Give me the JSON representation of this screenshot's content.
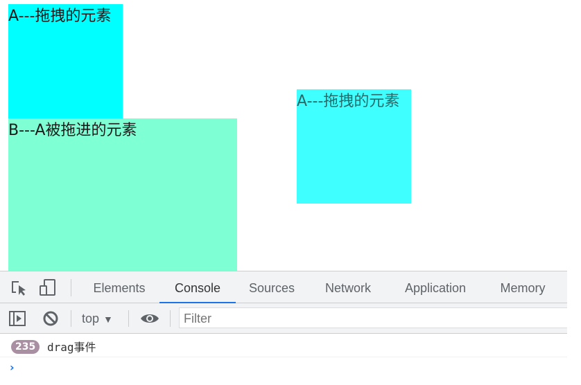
{
  "page": {
    "box_a": {
      "label": "A---拖拽的元素",
      "color": "#00ffff"
    },
    "box_b": {
      "label": "B---A被拖进的元素",
      "color": "#7fffd4"
    },
    "drag_ghost": {
      "label": "A---拖拽的元素"
    }
  },
  "devtools": {
    "toolbar_icons": [
      "inspect-element-icon",
      "device-toolbar-icon"
    ],
    "tabs": [
      {
        "label": "Elements",
        "active": false
      },
      {
        "label": "Console",
        "active": true
      },
      {
        "label": "Sources",
        "active": false
      },
      {
        "label": "Network",
        "active": false
      },
      {
        "label": "Application",
        "active": false
      },
      {
        "label": "Memory",
        "active": false
      }
    ],
    "console_toolbar": {
      "sidebar_icon": "show-sidebar-icon",
      "clear_icon": "clear-console-icon",
      "context": "top",
      "context_arrow": "▼",
      "eye_icon": "live-expression-icon",
      "filter_placeholder": "Filter"
    },
    "messages": [
      {
        "count": "235",
        "text": "drag事件"
      }
    ],
    "prompt": "›"
  }
}
